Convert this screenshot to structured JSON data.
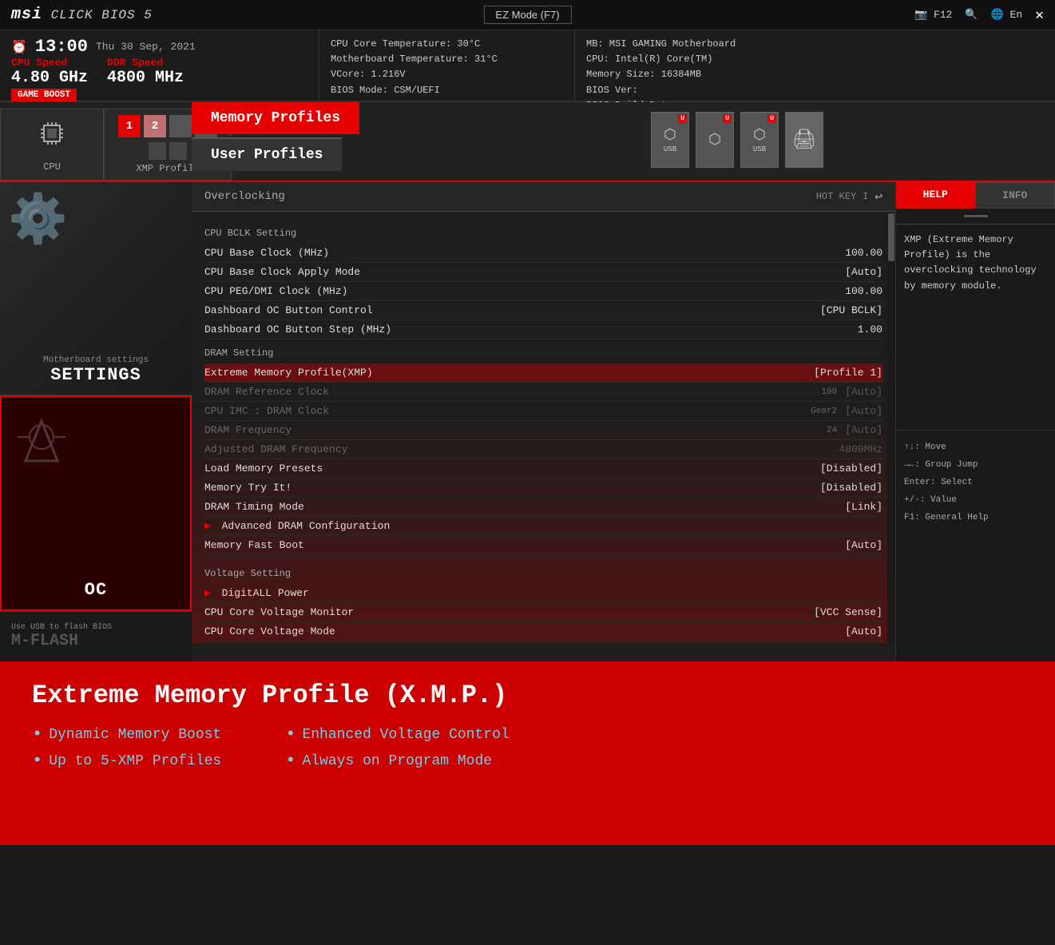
{
  "topbar": {
    "logo": "msi CLICK BIOS 5",
    "logo_msi": "msi",
    "logo_rest": " CLICK BIOS 5",
    "ez_mode": "EZ Mode (F7)",
    "f12": "F12",
    "lang": "En",
    "close": "✕"
  },
  "infobar": {
    "clock_icon": "⏰",
    "time": "13:00",
    "date": "Thu 30 Sep, 2021",
    "cpu_speed_label": "CPU Speed",
    "cpu_speed_val": "4.80 GHz",
    "ddr_speed_label": "DDR Speed",
    "ddr_speed_val": "4800 MHz",
    "game_boost": "GAME BOOST",
    "cpu_temp": "CPU Core Temperature: 30°C",
    "mb_temp": "Motherboard Temperature: 31°C",
    "vcore": "VCore: 1.216V",
    "bios_mode": "BIOS Mode: CSM/UEFI",
    "mb": "MB: MSI GAMING Motherboard",
    "cpu": "CPU: Intel(R) Core(TM)",
    "mem": "Memory Size: 16384MB",
    "bios_ver": "BIOS Ver:",
    "bios_build": "BIOS Build Date:"
  },
  "nav": {
    "cpu_label": "CPU",
    "xmp_label": "XMP Profile",
    "memory_profiles": "Memory Profiles",
    "user_profiles": "User Profiles",
    "xmp1": "1",
    "xmp2": "2",
    "usb_labels": [
      "USB",
      "USB",
      "USB",
      ""
    ]
  },
  "sidebar": {
    "settings_sub": "Motherboard settings",
    "settings_label": "SETTINGS",
    "oc_label": "OC",
    "mflash_sub": "Use USB to flash BIOS",
    "mflash_label": "M-FLASH"
  },
  "oc": {
    "title": "Overclocking",
    "hotkey": "HOT KEY",
    "separator": "I",
    "back": "↩",
    "sections": {
      "cpu_bclk": "CPU BCLK Setting",
      "dram": "DRAM Setting",
      "voltage": "Voltage Setting"
    },
    "settings": [
      {
        "name": "CPU Base Clock (MHz)",
        "val": "100.00",
        "extra": "",
        "dimmed": false,
        "highlighted": false
      },
      {
        "name": "CPU Base Clock Apply Mode",
        "val": "[Auto]",
        "extra": "",
        "dimmed": false,
        "highlighted": false
      },
      {
        "name": "CPU PEG/DMI Clock (MHz)",
        "val": "100.00",
        "extra": "",
        "dimmed": false,
        "highlighted": false
      },
      {
        "name": "Dashboard OC Button Control",
        "val": "[CPU BCLK]",
        "extra": "",
        "dimmed": false,
        "highlighted": false
      },
      {
        "name": "Dashboard OC Button Step (MHz)",
        "val": "1.00",
        "extra": "",
        "dimmed": false,
        "highlighted": false
      }
    ],
    "dram_settings": [
      {
        "name": "Extreme Memory Profile(XMP)",
        "val": "[Profile 1]",
        "extra": "",
        "dimmed": false,
        "highlighted": true
      },
      {
        "name": "DRAM Reference Clock",
        "val": "[Auto]",
        "extra": "100",
        "dimmed": true,
        "highlighted": false
      },
      {
        "name": "CPU IMC : DRAM Clock",
        "val": "[Auto]",
        "extra": "Gear2",
        "dimmed": true,
        "highlighted": false
      },
      {
        "name": "DRAM Frequency",
        "val": "[Auto]",
        "extra": "24",
        "dimmed": true,
        "highlighted": false
      },
      {
        "name": "Adjusted DRAM Frequency",
        "val": "4800MHz",
        "extra": "",
        "dimmed": true,
        "highlighted": false
      },
      {
        "name": "Load Memory Presets",
        "val": "[Disabled]",
        "extra": "",
        "dimmed": false,
        "highlighted": false
      },
      {
        "name": "Memory Try It!",
        "val": "[Disabled]",
        "extra": "",
        "dimmed": false,
        "highlighted": false
      },
      {
        "name": "DRAM Timing Mode",
        "val": "[Link]",
        "extra": "",
        "dimmed": false,
        "highlighted": false
      },
      {
        "name": "Advanced DRAM Configuration",
        "val": "",
        "extra": "",
        "dimmed": false,
        "highlighted": false,
        "arrow": true
      },
      {
        "name": "Memory Fast Boot",
        "val": "[Auto]",
        "extra": "",
        "dimmed": false,
        "highlighted": false
      }
    ],
    "voltage_settings": [
      {
        "name": "DigitALL Power",
        "val": "",
        "extra": "",
        "dimmed": false,
        "highlighted": false,
        "arrow": true
      },
      {
        "name": "CPU Core Voltage Monitor",
        "val": "[VCC Sense]",
        "extra": "",
        "dimmed": false,
        "highlighted": false
      },
      {
        "name": "CPU Core Voltage Mode",
        "val": "[Auto]",
        "extra": "",
        "dimmed": false,
        "highlighted": false
      }
    ]
  },
  "help": {
    "tab_help": "HELP",
    "tab_info": "INFO",
    "content": "XMP (Extreme Memory Profile) is the overclocking technology by memory module.",
    "footer": [
      "↑↓: Move",
      "→←: Group Jump",
      "Enter: Select",
      "+/-: Value",
      "F1: General Help"
    ]
  },
  "bottom": {
    "title": "Extreme Memory Profile (X.M.P.)",
    "features_left": [
      "Dynamic Memory Boost",
      "Up to 5-XMP Profiles"
    ],
    "features_right": [
      "Enhanced Voltage Control",
      "Always on Program Mode"
    ]
  }
}
